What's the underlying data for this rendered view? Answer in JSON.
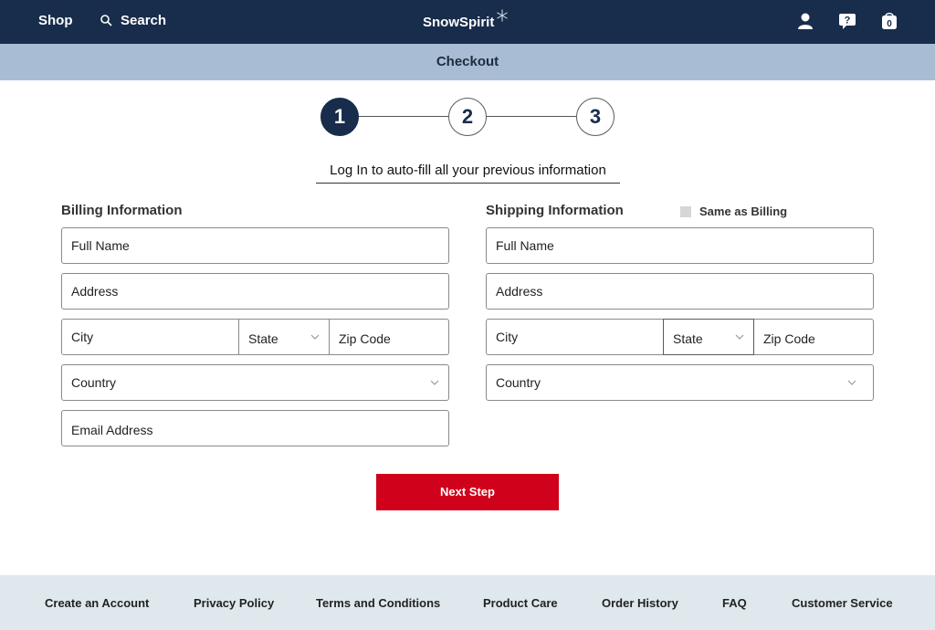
{
  "nav": {
    "shop_label": "Shop",
    "search_label": "Search",
    "brand": "SnowSpirit",
    "icons": [
      "user-icon",
      "help-icon",
      "bag-icon"
    ],
    "cart_count": "0",
    "help_mark": "?"
  },
  "banner": {
    "title": "Checkout"
  },
  "stepper": {
    "steps": [
      "1",
      "2",
      "3"
    ],
    "active": 1
  },
  "login": {
    "text": "Log In to auto-fill all your previous information"
  },
  "billing": {
    "title": "Billing Information",
    "full_name": "Full Name",
    "address": "Address",
    "city": "City",
    "state": "State",
    "zip": "Zip Code",
    "country": "Country",
    "email": "Email Address"
  },
  "shipping": {
    "title": "Shipping Information",
    "same_as_billing": "Same as Billing",
    "full_name": "Full Name",
    "address": "Address",
    "city": "City",
    "state": "State",
    "zip": "Zip Code",
    "country": "Country"
  },
  "actions": {
    "next_step": "Next Step"
  },
  "footer": {
    "links": [
      "Create an Account",
      "Privacy Policy",
      "Terms and Conditions",
      "Product Care",
      "Order History",
      "FAQ",
      "Customer Service"
    ]
  },
  "colors": {
    "nav_bg": "#182c4b",
    "banner_bg": "#a8bdd3",
    "primary_button": "#d0021b",
    "footer_bg": "#dfe8ec"
  }
}
